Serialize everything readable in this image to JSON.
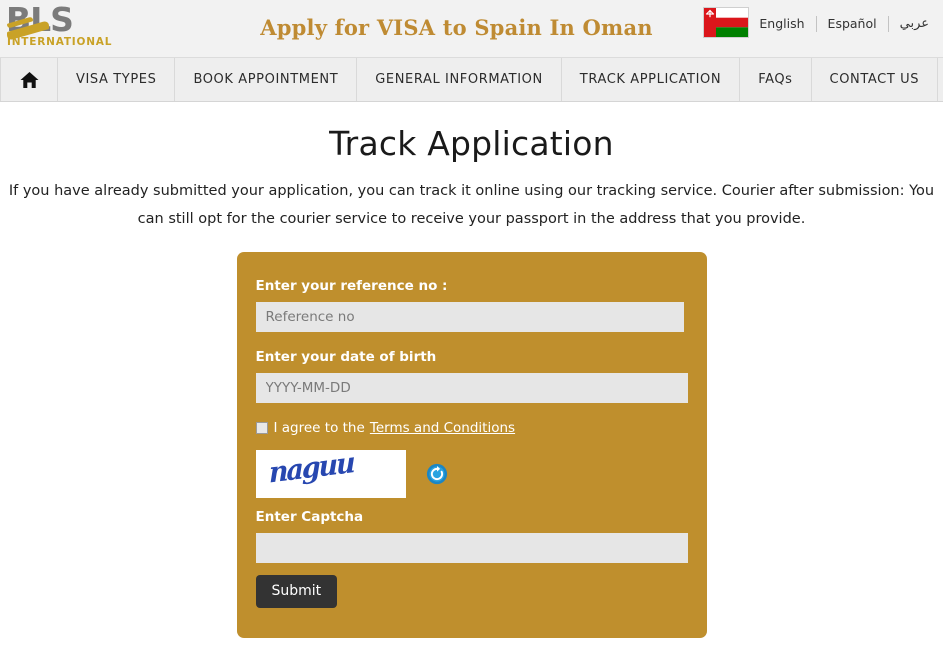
{
  "header": {
    "logo": {
      "primary_text": "BLS",
      "secondary_text": "INTERNATIONAL",
      "primary_color": "#7b7b7b",
      "accent_color": "#c9a227"
    },
    "title": "Apply for VISA to Spain In Oman",
    "title_color": "#bf8b33",
    "flag_name": "oman-flag",
    "languages": [
      {
        "label": "English",
        "name": "english"
      },
      {
        "label": "Español",
        "name": "espanol"
      },
      {
        "label": "عربي",
        "name": "arabic"
      }
    ]
  },
  "nav": {
    "home_icon": "home-icon",
    "items": [
      {
        "label": "VISA TYPES",
        "key": "visa-types"
      },
      {
        "label": "BOOK APPOINTMENT",
        "key": "book-appointment"
      },
      {
        "label": "GENERAL INFORMATION",
        "key": "general-information"
      },
      {
        "label": "TRACK APPLICATION",
        "key": "track-application"
      },
      {
        "label": "FAQs",
        "key": "faqs"
      },
      {
        "label": "CONTACT US",
        "key": "contact-us"
      }
    ]
  },
  "main": {
    "page_title": "Track Application",
    "description": "If you have already submitted your application, you can track it online using our tracking service. Courier after submission: You can still opt for the courier service to receive your passport in the address that you provide."
  },
  "form": {
    "panel_color": "#bf8f2d",
    "reference": {
      "label": "Enter your reference no :",
      "placeholder": "Reference no",
      "value": ""
    },
    "dob": {
      "label": "Enter your date of birth",
      "placeholder": "YYYY-MM-DD",
      "value": ""
    },
    "agreement": {
      "checked": false,
      "text": "I agree to the",
      "link_label": "Terms and Conditions"
    },
    "captcha": {
      "image_text": "naguu",
      "image_color": "#2747b0",
      "refresh_icon": "refresh-icon",
      "label": "Enter Captcha",
      "placeholder": "",
      "value": ""
    },
    "submit_label": "Submit"
  }
}
